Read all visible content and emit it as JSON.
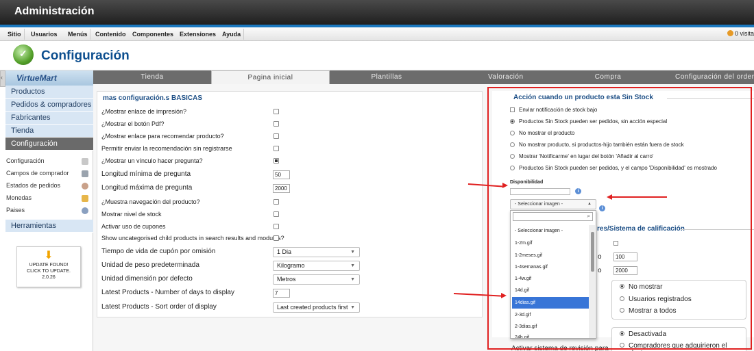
{
  "header": {
    "title": "Administración"
  },
  "menubar": {
    "items": [
      "Sitio",
      "Usuarios",
      "Menús",
      "Contenido",
      "Componentes",
      "Extensiones",
      "Ayuda"
    ],
    "visitors": "0 visita"
  },
  "page": {
    "title": "Configuración"
  },
  "sidebar": {
    "logo": "VirtueMart",
    "items": [
      "Productos",
      "Pedidos & compradores",
      "Fabricantes",
      "Tienda",
      "Configuración"
    ],
    "subitems": [
      "Configuración",
      "Campos de comprador",
      "Estados de pedidos",
      "Monedas",
      "Paises"
    ],
    "tools": "Herramientas",
    "update": {
      "line1": "UPDATE FOUND!",
      "line2": "CLICK TO UPDATE.",
      "line3": "2.0.26"
    }
  },
  "tabs": [
    "Tienda",
    "Pagina inicial",
    "Plantillas",
    "Valoración",
    "Compra",
    "Configuración del order"
  ],
  "basic": {
    "title": "mas configuración.s BASICAS",
    "rows": [
      {
        "label": "¿Mostrar enlace de impresión?",
        "type": "checkbox",
        "checked": false
      },
      {
        "label": "¿Mostrar el botón Pdf?",
        "type": "checkbox",
        "checked": false
      },
      {
        "label": "¿Mostrar enlace para recomendar producto?",
        "type": "checkbox",
        "checked": false
      },
      {
        "label": "Permitir enviar la recomendación sin registrarse",
        "type": "checkbox",
        "checked": false
      },
      {
        "label": "¿Mostrar un vínculo hacer pregunta?",
        "type": "checkbox",
        "checked": true
      },
      {
        "label": "Longitud mínima de pregunta",
        "type": "text",
        "value": "50"
      },
      {
        "label": "Longitud máxima de pregunta",
        "type": "text",
        "value": "2000"
      },
      {
        "label": "¿Muestra navegación del producto?",
        "type": "checkbox",
        "checked": false
      },
      {
        "label": "Mostrar nivel de stock",
        "type": "checkbox",
        "checked": false
      },
      {
        "label": "Activar uso de cupones",
        "type": "checkbox",
        "checked": false
      },
      {
        "label": "Show uncategorised child products in search results and modules?",
        "type": "checkbox",
        "checked": false
      },
      {
        "label": "Tiempo de vida de cupón por omisión",
        "type": "select",
        "value": "1 Dia"
      },
      {
        "label": "Unidad de peso predeterminada",
        "type": "select",
        "value": "Kilogramo"
      },
      {
        "label": "Unidad dimensión por defecto",
        "type": "select",
        "value": "Metros"
      },
      {
        "label": "Latest Products - Number of days to display",
        "type": "text",
        "value": "7"
      },
      {
        "label": "Latest Products - Sort order of display",
        "type": "select",
        "value": "Last created products first"
      }
    ]
  },
  "stock": {
    "title": "Acción cuando un producto esta Sin Stock",
    "options": [
      {
        "label": "Enviar notificación de stock bajo",
        "kind": "checkbox"
      },
      {
        "label": "Productos Sin Stock pueden ser pedidos, sin acción especial",
        "kind": "radio",
        "on": true
      },
      {
        "label": "No mostrar el producto",
        "kind": "radio",
        "on": false
      },
      {
        "label": "No mostrar producto, si productos-hijo también están fuera de stock",
        "kind": "radio",
        "on": false
      },
      {
        "label": "Mostrar 'Notificarme' en lugar del botón 'Añadir al carro'",
        "kind": "radio",
        "on": false
      },
      {
        "label": "Productos Sin Stock pueden ser pedidos, y el campo 'Disponibilidad' es mostrado",
        "kind": "radio",
        "on": false
      }
    ],
    "availability_label": "Disponibilidad",
    "image_select": "- Seleccionar imagen -",
    "image_options": [
      "- Seleccionar imagen -",
      "1-2m.gif",
      "1-2meses.gif",
      "1-4semanas.gif",
      "1-4w.gif",
      "14d.gif",
      "14dias.gif",
      "2-3d.gif",
      "2-3dias.gif",
      "24h.gif"
    ],
    "image_highlight": "14dias.gif"
  },
  "rating": {
    "title": "res/Sistema de calificación",
    "o1": "o",
    "v1": "100",
    "o2": "o",
    "v2": "2000",
    "show_opts": [
      "No mostrar",
      "Usuarios registrados",
      "Mostrar a todos"
    ],
    "review_opts": [
      "Desactivada",
      "Compradores que adquirieron el producto"
    ],
    "review_label": "Activar sistema de revisión para"
  }
}
